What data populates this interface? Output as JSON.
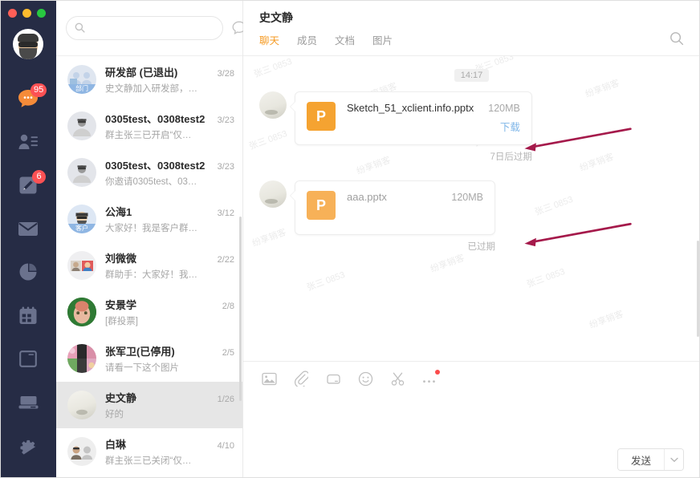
{
  "window": {
    "traffic_lights": [
      "close",
      "minimize",
      "maximize"
    ],
    "accent_orange": "#f59a23",
    "rail_bg": "#262c45",
    "badge_red": "#fc5154",
    "link_blue": "#7fb6e8",
    "arrow_color": "#a51a4b"
  },
  "rail": {
    "avatar_name": "user-avatar",
    "items": [
      {
        "name": "messages",
        "icon": "chat-bubble-icon",
        "badge": "95"
      },
      {
        "name": "contacts",
        "icon": "contacts-icon",
        "badge": ""
      },
      {
        "name": "notes",
        "icon": "edit-note-icon",
        "badge": "6"
      },
      {
        "name": "mail",
        "icon": "mail-icon",
        "badge": ""
      },
      {
        "name": "reports",
        "icon": "pie-chart-icon",
        "badge": ""
      },
      {
        "name": "calendar",
        "icon": "calendar-icon",
        "badge": ""
      },
      {
        "name": "workspace",
        "icon": "window-icon",
        "badge": ""
      },
      {
        "name": "devices",
        "icon": "laptop-icon",
        "badge": ""
      },
      {
        "name": "settings",
        "icon": "gear-icon",
        "badge": ""
      }
    ]
  },
  "search": {
    "placeholder": "",
    "value": "",
    "icon": "search-icon",
    "new_chat_icon": "new-chat-icon"
  },
  "chat_list": [
    {
      "name": "研发部 (已退出)",
      "date": "3/28",
      "preview": "史文静加入研发部，…",
      "avatar_tag": "部门",
      "avatar_kind": "group-dept",
      "active": false
    },
    {
      "name": "0305test、0308test2",
      "date": "3/23",
      "preview": "群主张三已开启“仅…",
      "avatar_tag": "",
      "avatar_kind": "person-shades",
      "active": false
    },
    {
      "name": "0305test、0308test2",
      "date": "3/23",
      "preview": "你邀请0305test、03…",
      "avatar_tag": "",
      "avatar_kind": "person-shades",
      "active": false
    },
    {
      "name": "公海1",
      "date": "3/12",
      "preview": "大家好！我是客户群…",
      "avatar_tag": "客户",
      "avatar_kind": "person-hat",
      "active": false
    },
    {
      "name": "刘微微",
      "date": "2/22",
      "preview": "群助手：大家好！我…",
      "avatar_tag": "",
      "avatar_kind": "multi-photo",
      "active": false
    },
    {
      "name": "安景学",
      "date": "2/8",
      "preview": "[群投票]",
      "avatar_tag": "",
      "avatar_kind": "photo-green",
      "active": false
    },
    {
      "name": "张军卫(已停用)",
      "date": "2/5",
      "preview": "请看一下这个图片",
      "avatar_tag": "",
      "avatar_kind": "photo-collage",
      "active": false
    },
    {
      "name": "史文静",
      "date": "1/26",
      "preview": "好的",
      "avatar_tag": "",
      "avatar_kind": "photo-cream",
      "active": true
    },
    {
      "name": "白琳",
      "date": "4/10",
      "preview": "群主张三已关闭“仅…",
      "avatar_tag": "",
      "avatar_kind": "duo-person",
      "active": false
    }
  ],
  "conversation": {
    "title": "史文静",
    "tabs": [
      {
        "label": "聊天",
        "active": true
      },
      {
        "label": "成员",
        "active": false
      },
      {
        "label": "文档",
        "active": false
      },
      {
        "label": "图片",
        "active": false
      }
    ],
    "search_icon": "search-icon",
    "timestamp": "14:17",
    "watermarks": [
      "张三 0853",
      "纷享销客"
    ],
    "messages": [
      {
        "file_icon_letter": "P",
        "file_name": "Sketch_51_xclient.info.pptx",
        "file_size": "120MB",
        "action_label": "下载",
        "expired": false,
        "expiry_note": "7日后过期"
      },
      {
        "file_icon_letter": "P",
        "file_name": "aaa.pptx",
        "file_size": "120MB",
        "action_label": "",
        "expired": true,
        "expiry_note": "已过期"
      }
    ]
  },
  "composer": {
    "tools": [
      {
        "name": "image",
        "icon": "image-icon",
        "dot": false
      },
      {
        "name": "attachment",
        "icon": "paperclip-icon",
        "dot": false
      },
      {
        "name": "cloud-drive",
        "icon": "drive-icon",
        "dot": false
      },
      {
        "name": "emoji",
        "icon": "smiley-icon",
        "dot": false
      },
      {
        "name": "screenshot",
        "icon": "scissors-icon",
        "dot": false
      },
      {
        "name": "more",
        "icon": "ellipsis-icon",
        "dot": true
      }
    ],
    "input_value": "",
    "input_placeholder": "",
    "send_label": "发送",
    "send_caret_icon": "chevron-down-icon"
  }
}
